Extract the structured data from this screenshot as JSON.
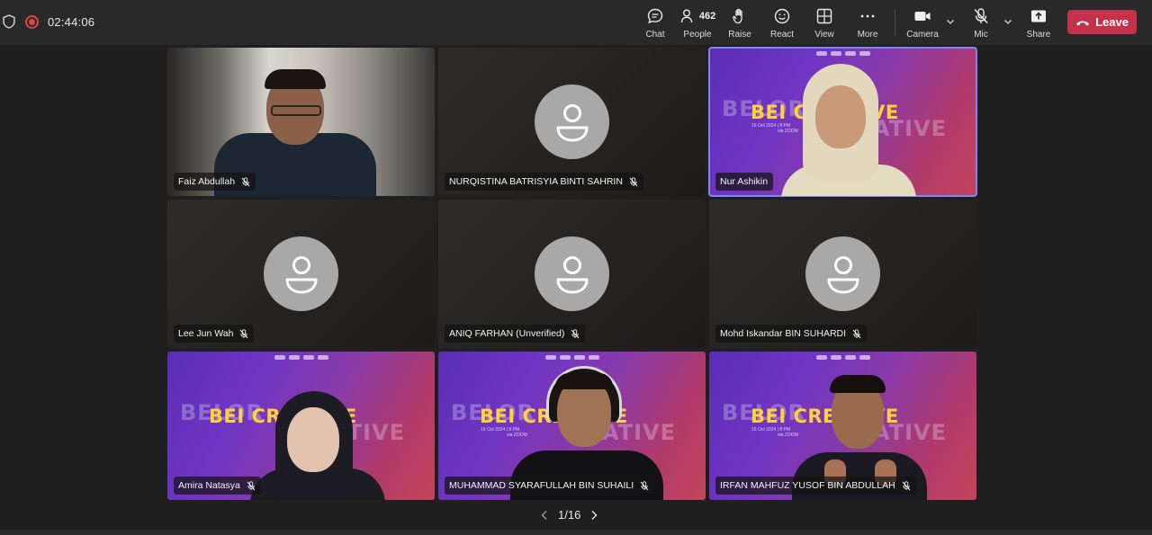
{
  "meeting": {
    "timer": "02:44:06"
  },
  "toolbar": {
    "chat_label": "Chat",
    "people_label": "People",
    "people_count": "462",
    "raise_label": "Raise",
    "react_label": "React",
    "view_label": "View",
    "more_label": "More",
    "camera_label": "Camera",
    "mic_label": "Mic",
    "share_label": "Share",
    "leave_label": "Leave"
  },
  "colors": {
    "leave": "#c4314b",
    "active_speaker": "#7f85f5",
    "recording": "#e0424b"
  },
  "participants": [
    {
      "name": "Faiz Abdullah",
      "muted": true,
      "video": "camera"
    },
    {
      "name": "NURQISTINA BATRISYIA BINTI SAHRIN",
      "muted": true,
      "video": "none"
    },
    {
      "name": "Nur Ashikin",
      "muted": false,
      "video": "camera",
      "active": true
    },
    {
      "name": "Lee Jun Wah",
      "muted": true,
      "video": "none"
    },
    {
      "name": "ANIQ FARHAN (Unverified)",
      "muted": true,
      "video": "none"
    },
    {
      "name": "Mohd Iskandar BIN SUHARDI",
      "muted": true,
      "video": "none"
    },
    {
      "name": "Amira Natasya",
      "muted": true,
      "video": "camera"
    },
    {
      "name": "MUHAMMAD SYARAFULLAH BIN SUHAILI",
      "muted": true,
      "video": "camera"
    },
    {
      "name": "IRFAN MAHFUZ YUSOF BIN ABDULLAH",
      "muted": true,
      "video": "camera"
    }
  ],
  "background_banner": {
    "title": "BEI CREATIVE",
    "ghost_a": "BELOR",
    "ghost_b": "ATIVE",
    "date_line": "16 Oct 2024 | 8 PM",
    "via_line": "via ZOOM"
  },
  "pagination": {
    "label": "1/16"
  }
}
